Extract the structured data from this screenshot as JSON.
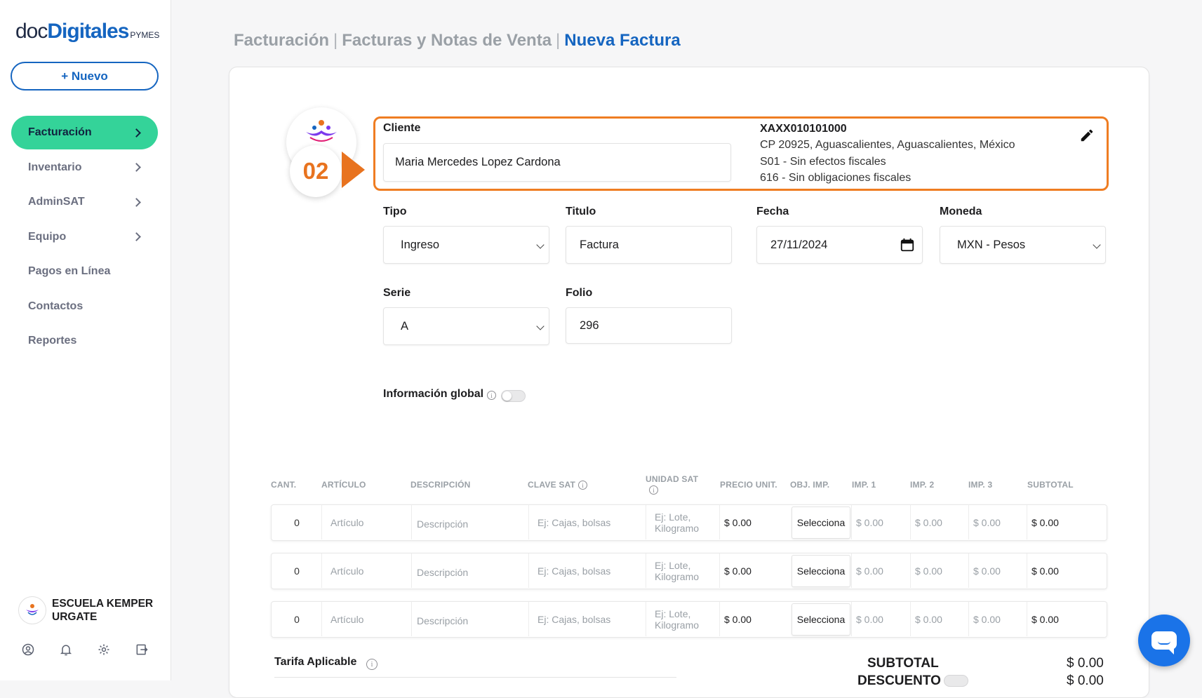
{
  "brand": {
    "doc": "doc",
    "digitales": "Digitales",
    "pymes": "PYMES"
  },
  "sidebar": {
    "new_button": "+ Nuevo",
    "items": [
      {
        "label": "Facturación",
        "active": true,
        "has_chevron": true
      },
      {
        "label": "Inventario",
        "active": false,
        "has_chevron": true
      },
      {
        "label": "AdminSAT",
        "active": false,
        "has_chevron": true
      },
      {
        "label": "Equipo",
        "active": false,
        "has_chevron": true
      },
      {
        "label": "Pagos en Línea",
        "active": false,
        "has_chevron": false
      },
      {
        "label": "Contactos",
        "active": false,
        "has_chevron": false
      },
      {
        "label": "Reportes",
        "active": false,
        "has_chevron": false
      }
    ],
    "user": {
      "name": "ESCUELA KEMPER URGATE"
    },
    "bottom_icons": [
      "user-circle-icon",
      "bell-icon",
      "gear-icon",
      "logout-icon"
    ]
  },
  "breadcrumb": {
    "items": [
      "Facturación",
      "Facturas y Notas de Venta",
      "Nueva Factura"
    ],
    "separator": "|"
  },
  "step": {
    "number": "02"
  },
  "client": {
    "label": "Cliente",
    "value": "Maria Mercedes Lopez Cardona",
    "rfc": "XAXX010101000",
    "address": "CP 20925, Aguascalientes, Aguascalientes, México",
    "uso_cfdi": "S01 - Sin efectos fiscales",
    "regimen": "616 - Sin obligaciones fiscales"
  },
  "form": {
    "tipo": {
      "label": "Tipo",
      "value": "Ingreso"
    },
    "titulo": {
      "label": "Titulo",
      "value": "Factura"
    },
    "fecha": {
      "label": "Fecha",
      "value": "27/11/2024"
    },
    "moneda": {
      "label": "Moneda",
      "value": "MXN - Pesos"
    },
    "serie": {
      "label": "Serie",
      "value": "A"
    },
    "folio": {
      "label": "Folio",
      "value": "296"
    },
    "info_global": {
      "label": "Información global",
      "enabled": false
    }
  },
  "table": {
    "headers": [
      "CANT.",
      "ARTÍCULO",
      "DESCRIPCIÓN",
      "CLAVE SAT",
      "UNIDAD SAT",
      "PRECIO UNIT.",
      "OBJ. IMP.",
      "IMP. 1",
      "IMP. 2",
      "IMP. 3",
      "SUBTOTAL"
    ],
    "rows": [
      {
        "cant": "0",
        "articulo": "Artículo",
        "descripcion": "Descripción",
        "clave_sat": "Ej: Cajas, bolsas",
        "unidad_sat_1": "Ej: Lote,",
        "unidad_sat_2": "Kilogramo",
        "precio": "$ 0.00",
        "obj_imp": "Selecciona",
        "imp1": "$ 0.00",
        "imp2": "$ 0.00",
        "imp3": "$ 0.00",
        "subtotal": "$ 0.00"
      },
      {
        "cant": "0",
        "articulo": "Artículo",
        "descripcion": "Descripción",
        "clave_sat": "Ej: Cajas, bolsas",
        "unidad_sat_1": "Ej: Lote,",
        "unidad_sat_2": "Kilogramo",
        "precio": "$ 0.00",
        "obj_imp": "Selecciona",
        "imp1": "$ 0.00",
        "imp2": "$ 0.00",
        "imp3": "$ 0.00",
        "subtotal": "$ 0.00"
      },
      {
        "cant": "0",
        "articulo": "Artículo",
        "descripcion": "Descripción",
        "clave_sat": "Ej: Cajas, bolsas",
        "unidad_sat_1": "Ej: Lote,",
        "unidad_sat_2": "Kilogramo",
        "precio": "$ 0.00",
        "obj_imp": "Selecciona",
        "imp1": "$ 0.00",
        "imp2": "$ 0.00",
        "imp3": "$ 0.00",
        "subtotal": "$ 0.00"
      }
    ]
  },
  "totals": {
    "tarifa_label": "Tarifa Aplicable",
    "subtotal_label": "SUBTOTAL",
    "subtotal_value": "$ 0.00",
    "descuento_label": "DESCUENTO",
    "descuento_value": "$ 0.00"
  },
  "colors": {
    "accent": "#1565c0",
    "active_nav": "#34d399",
    "highlight": "#ef7d22",
    "chat": "#1a73e8"
  }
}
